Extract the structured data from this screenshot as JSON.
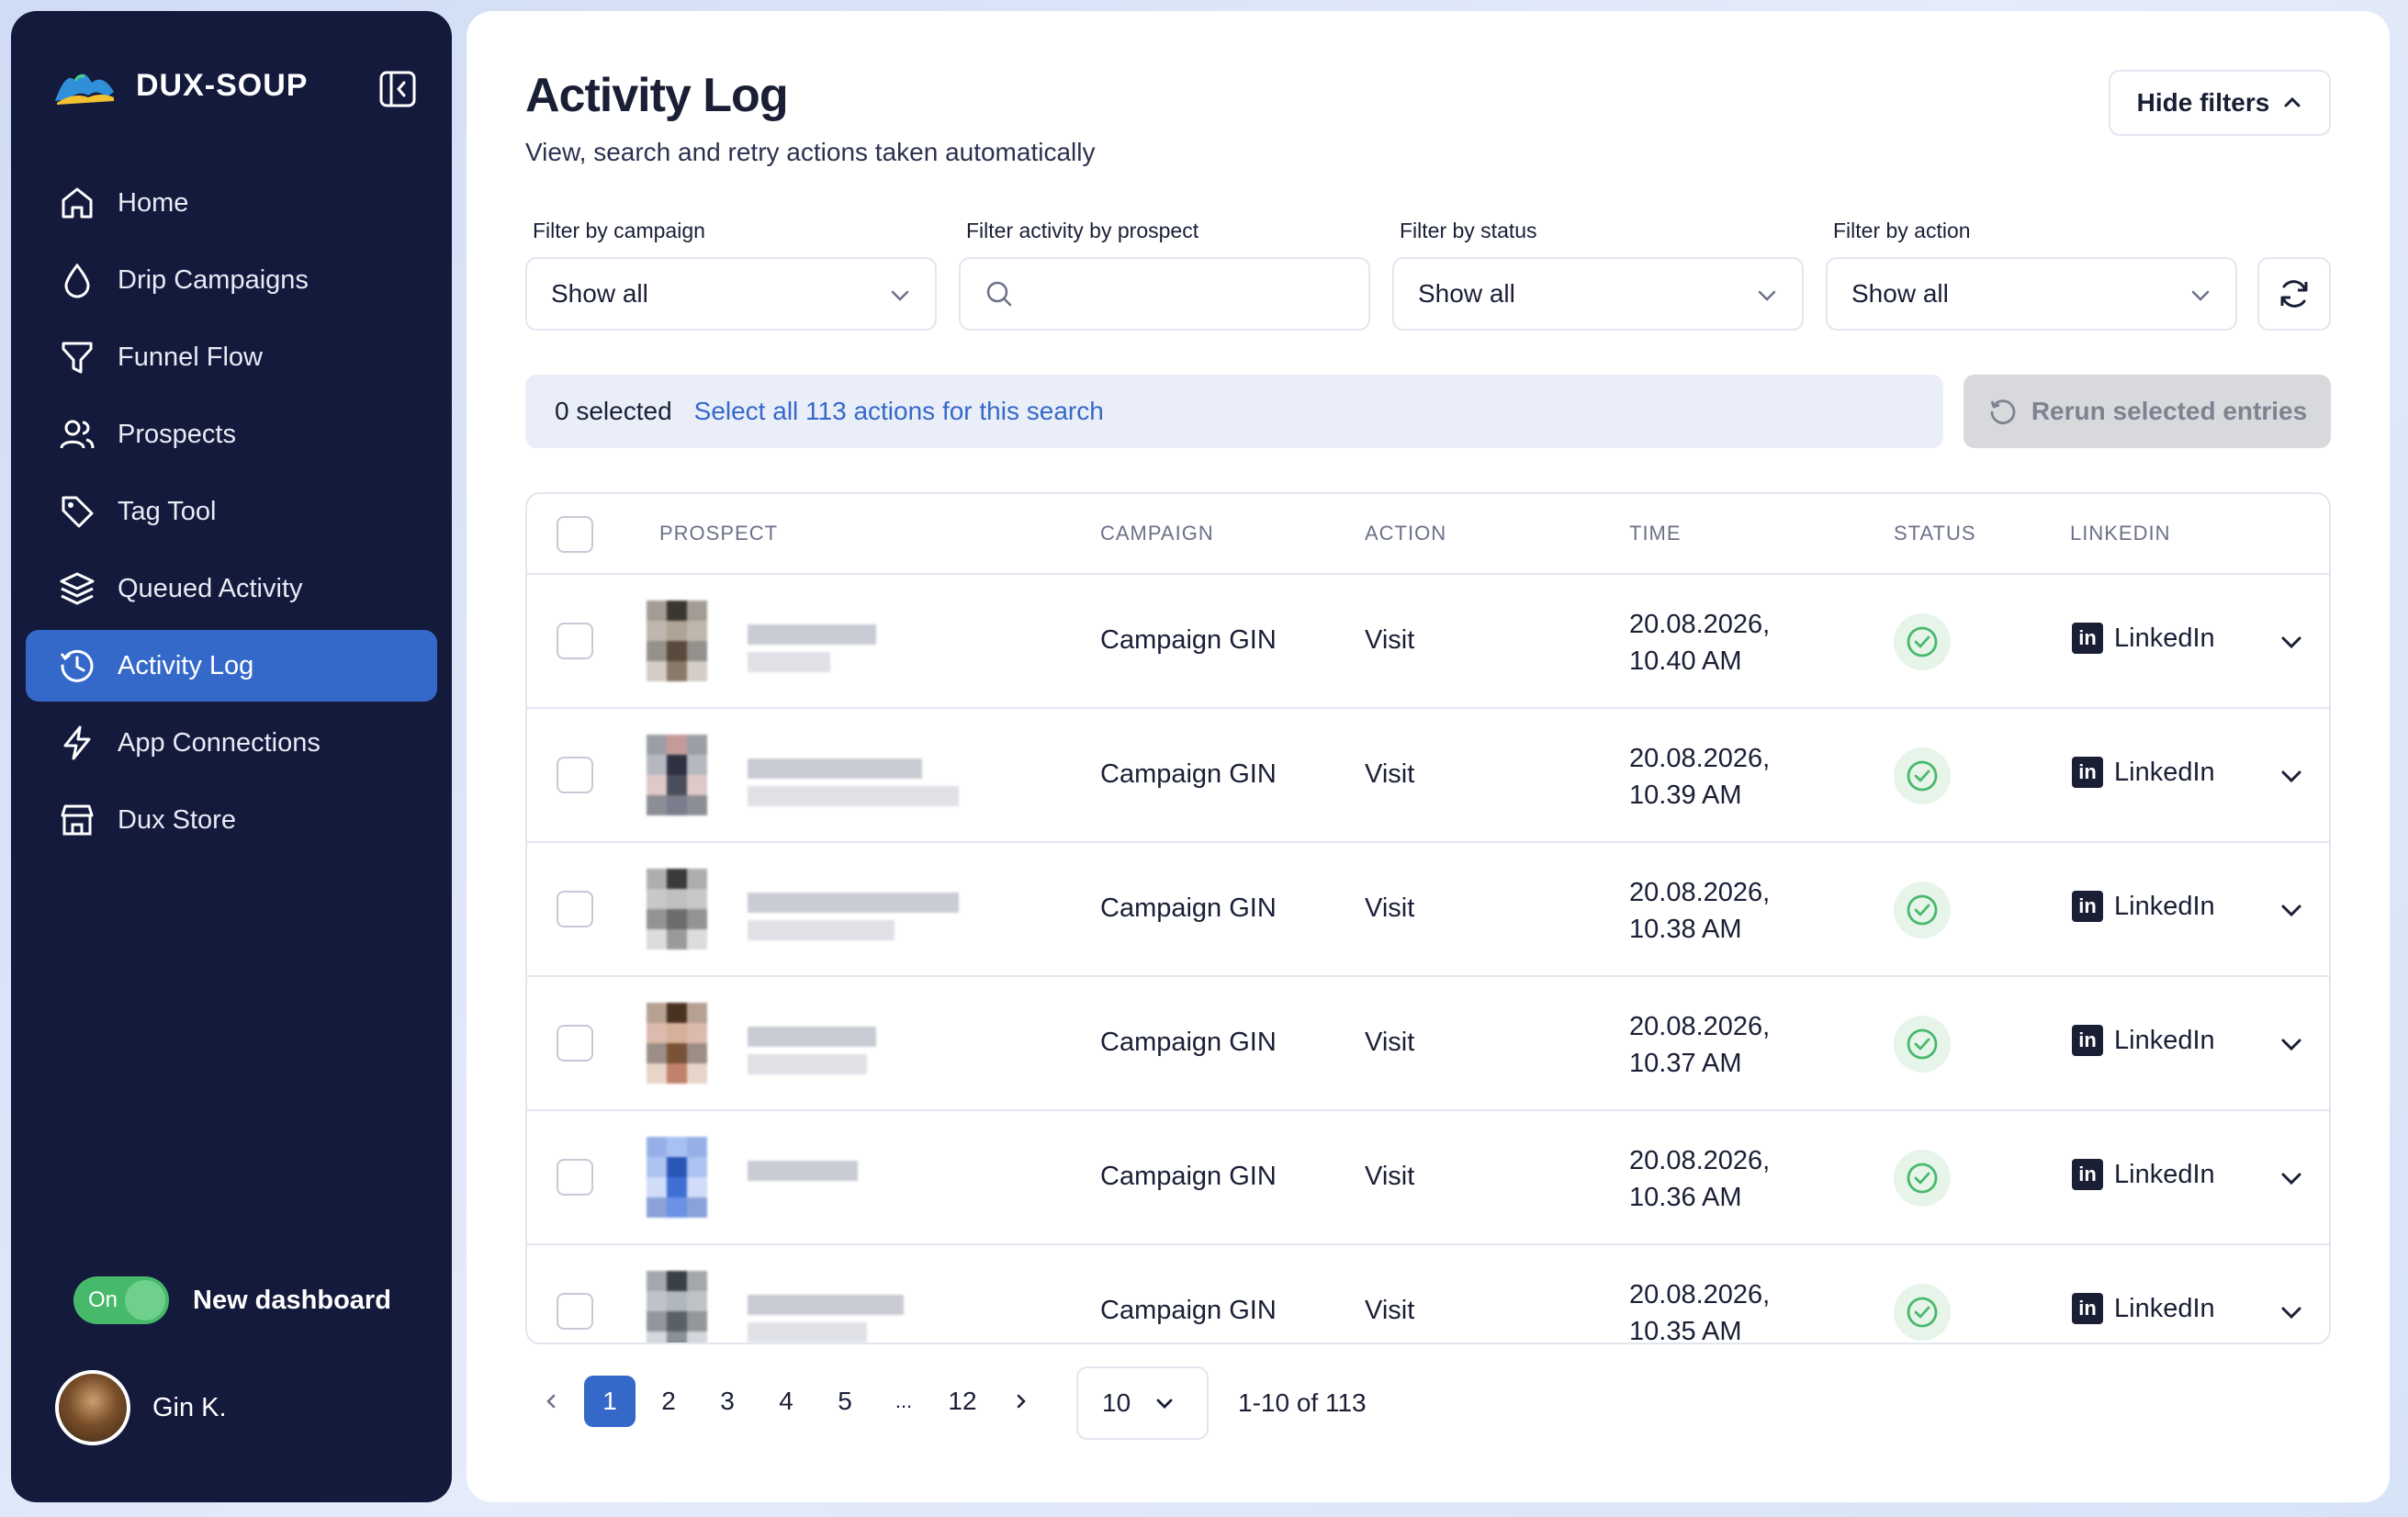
{
  "sidebar": {
    "brand": "DUX-SOUP",
    "items": [
      {
        "label": "Home",
        "icon": "home-icon"
      },
      {
        "label": "Drip Campaigns",
        "icon": "drop-icon"
      },
      {
        "label": "Funnel Flow",
        "icon": "funnel-icon"
      },
      {
        "label": "Prospects",
        "icon": "users-icon"
      },
      {
        "label": "Tag Tool",
        "icon": "tag-icon"
      },
      {
        "label": "Queued Activity",
        "icon": "layers-icon"
      },
      {
        "label": "Activity Log",
        "icon": "history-icon",
        "active": true
      },
      {
        "label": "App Connections",
        "icon": "bolt-icon"
      },
      {
        "label": "Dux Store",
        "icon": "store-icon"
      }
    ],
    "toggle_state": "On",
    "toggle_label": "New dashboard",
    "user_name": "Gin K."
  },
  "header": {
    "title": "Activity Log",
    "subtitle": "View, search and retry actions taken automatically",
    "hide_filters": "Hide filters"
  },
  "filters": {
    "campaign_label": "Filter by campaign",
    "campaign_value": "Show all",
    "prospect_label": "Filter activity by prospect",
    "prospect_value": "",
    "status_label": "Filter by status",
    "status_value": "Show all",
    "action_label": "Filter by action",
    "action_value": "Show all"
  },
  "selection": {
    "count_text": "0 selected",
    "select_all_text": "Select all 113 actions for this search",
    "rerun_label": "Rerun selected entries"
  },
  "table": {
    "headers": [
      "PROSPECT",
      "CAMPAIGN",
      "ACTION",
      "TIME",
      "STATUS",
      "LINKEDIN"
    ],
    "rows": [
      {
        "campaign": "Campaign GIN",
        "action": "Visit",
        "date": "20.08.2026,",
        "time": "10.40 AM",
        "linkedin": "LinkedIn"
      },
      {
        "campaign": "Campaign GIN",
        "action": "Visit",
        "date": "20.08.2026,",
        "time": "10.39 AM",
        "linkedin": "LinkedIn"
      },
      {
        "campaign": "Campaign GIN",
        "action": "Visit",
        "date": "20.08.2026,",
        "time": "10.38 AM",
        "linkedin": "LinkedIn"
      },
      {
        "campaign": "Campaign GIN",
        "action": "Visit",
        "date": "20.08.2026,",
        "time": "10.37 AM",
        "linkedin": "LinkedIn"
      },
      {
        "campaign": "Campaign GIN",
        "action": "Visit",
        "date": "20.08.2026,",
        "time": "10.36 AM",
        "linkedin": "LinkedIn"
      },
      {
        "campaign": "Campaign GIN",
        "action": "Visit",
        "date": "20.08.2026,",
        "time": "10.35 AM",
        "linkedin": "LinkedIn"
      }
    ]
  },
  "pagination": {
    "pages": [
      "1",
      "2",
      "3",
      "4",
      "5",
      "...",
      "12"
    ],
    "current": "1",
    "per_page": "10",
    "range": "1-10 of 113"
  },
  "colors": {
    "sidebar_bg": "#141a3c",
    "accent": "#3569c9",
    "success": "#47b96b"
  }
}
